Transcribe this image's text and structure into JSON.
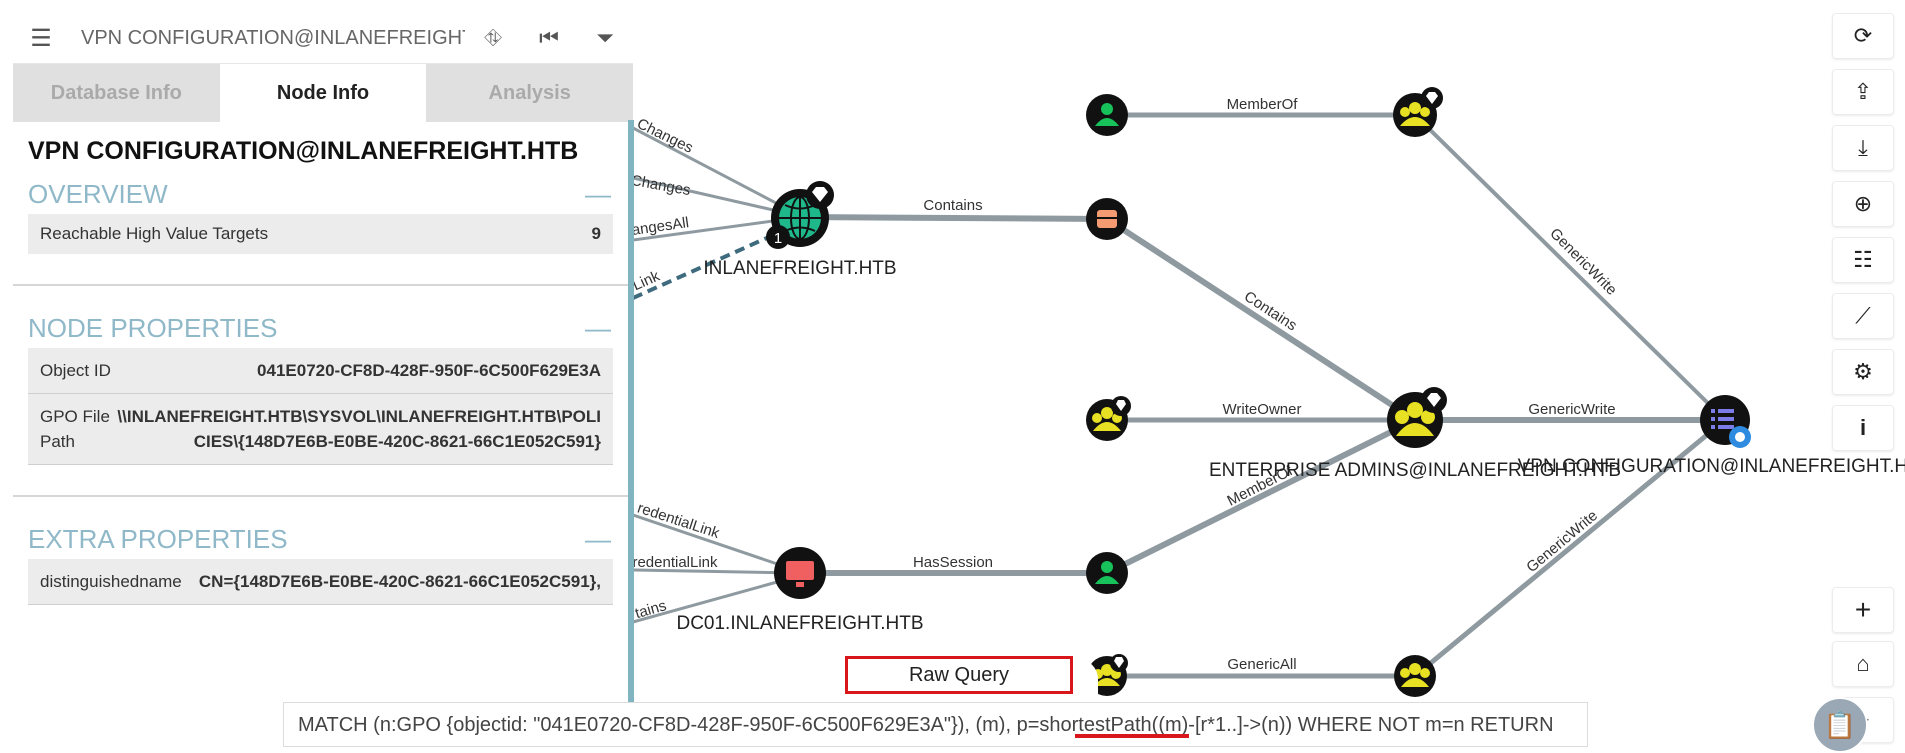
{
  "header": {
    "search_value": "VPN CONFIGURATION@INLANEFREIGHT.HTB",
    "menu_icon": "hamburger-icon",
    "icons": [
      "path-finding-icon",
      "back-icon",
      "filter-icon"
    ]
  },
  "tabs": [
    {
      "label": "Database Info",
      "active": false
    },
    {
      "label": "Node Info",
      "active": true
    },
    {
      "label": "Analysis",
      "active": false
    }
  ],
  "node": {
    "title": "VPN CONFIGURATION@INLANEFREIGHT.HTB",
    "overview": {
      "heading": "OVERVIEW",
      "collapse": "—",
      "rows": [
        {
          "label": "Reachable High Value Targets",
          "value": "9"
        }
      ]
    },
    "node_properties": {
      "heading": "NODE PROPERTIES",
      "collapse": "—",
      "rows": [
        {
          "key": "Object ID",
          "value": "041E0720-CF8D-428F-950F-6C500F629E3A"
        },
        {
          "key": "GPO File Path",
          "value": "\\\\INLANEFREIGHT.HTB\\SYSVOL\\INLANEFREIGHT.HTB\\POLICIES\\{148D7E6B-E0BE-420C-8621-66C1E052C591}"
        }
      ]
    },
    "extra_properties": {
      "heading": "EXTRA PROPERTIES",
      "collapse": "—",
      "rows": [
        {
          "key": "distinguishedname",
          "value": "CN={148D7E6B-E0BE-420C-8621-66C1E052C591},"
        }
      ]
    }
  },
  "graph": {
    "node_labels": {
      "domain": "INLANEFREIGHT.HTB",
      "computer": "DC01.INLANEFREIGHT.HTB",
      "enterprise_admins": "ENTERPRISE ADMINS@INLANEFREIGHT.HTB",
      "vpn_config": "VPN CONFIGURATION@INLANEFREIGHT.HTB"
    },
    "edge_labels": {
      "memberof_top": "MemberOf",
      "contains_domain_ou": "Contains",
      "contains_ou_ea": "Contains",
      "writeowner": "WriteOwner",
      "genericwrite_ea_vpn": "GenericWrite",
      "genericwrite_top_vpn": "GenericWrite",
      "genericwrite_bottom_vpn": "GenericWrite",
      "hassession": "HasSession",
      "memberof_user_ea": "MemberOf",
      "genericall": "GenericAll",
      "left_changes1": "Changes",
      "left_changes2": "Changes",
      "left_changesall": "angesAll",
      "left_link": "Link",
      "left_credlink1": "redentialLink",
      "left_credlink2": "redentialLink",
      "left_contains": "tains"
    },
    "badge_count": "1"
  },
  "toolbar_icons": [
    "refresh-icon",
    "upload-icon",
    "download-icon",
    "upload-circle-icon",
    "checklist-icon",
    "chart-icon",
    "settings-icon",
    "info-icon",
    "zoom-in-icon",
    "home-icon",
    "zoom-out-icon"
  ],
  "toolbar_info_label": "i",
  "toolbar_zoom_in_label": "+",
  "raw_query": {
    "label": "Raw Query",
    "query": "MATCH (n:GPO {objectid: \"041E0720-CF8D-428F-950F-6C500F629E3A\"}), (m), p=shortestPath((m)-[r*1..]->(n)) WHERE NOT m=n RETURN"
  }
}
